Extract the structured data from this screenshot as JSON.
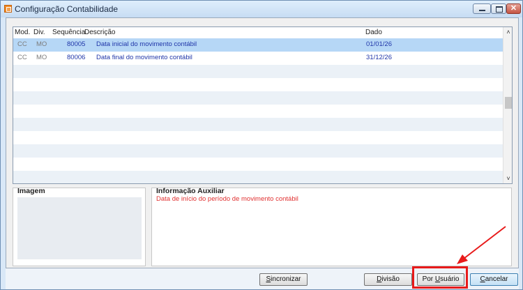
{
  "window": {
    "title": "Configuração Contabilidade",
    "close_glyph": "✕"
  },
  "grid": {
    "columns": [
      "Mod.",
      "Div.",
      "Sequência",
      "Descrição",
      "Dado"
    ],
    "rows": [
      {
        "mod": "CC",
        "div": "MO",
        "seq": "80005",
        "desc": "Data inicial do movimento contábil",
        "dado": "01/01/26",
        "selected": true
      },
      {
        "mod": "CC",
        "div": "MO",
        "seq": "80006",
        "desc": "Data final do movimento contábil",
        "dado": "31/12/26",
        "selected": false
      }
    ],
    "empty_row_count": 9,
    "scroll_up_glyph": "˄",
    "scroll_down_glyph": "˅"
  },
  "panels": {
    "image_title": "Imagem",
    "info_title": "Informação Auxiliar",
    "info_text": "Data de início do período de movimento contábil"
  },
  "buttons": {
    "sincronizar": {
      "pre": "",
      "ul": "S",
      "post": "incronizar"
    },
    "divisao": {
      "pre": "",
      "ul": "D",
      "post": "ivisão"
    },
    "por_usuario": {
      "pre": "Por ",
      "ul": "U",
      "post": "suário"
    },
    "cancelar": {
      "pre": "",
      "ul": "C",
      "post": "ancelar"
    }
  },
  "annotation": {
    "highlight_color": "#e81a1a"
  },
  "colors": {
    "selected_row": "#b6d7f6",
    "info_text": "#e03030",
    "grid_text": "#1f35a8"
  }
}
